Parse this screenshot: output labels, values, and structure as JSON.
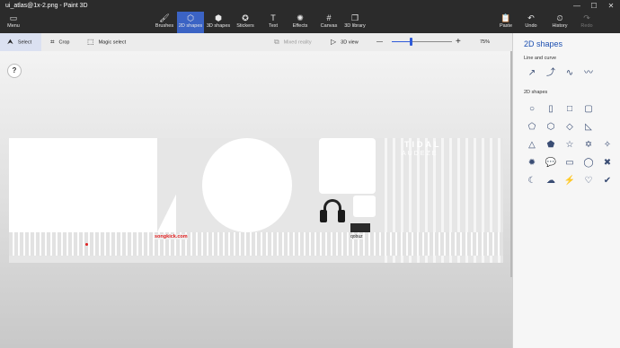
{
  "window": {
    "title": "ui_atlas@1x-2.png - Paint 3D",
    "minimize": "—",
    "maximize": "☐",
    "close": "✕"
  },
  "ribbon": {
    "menu": "Menu",
    "tabs": [
      {
        "label": "Brushes",
        "icon": "🖌"
      },
      {
        "label": "2D shapes",
        "icon": "⬡"
      },
      {
        "label": "3D shapes",
        "icon": "⬢"
      },
      {
        "label": "Stickers",
        "icon": "✪"
      },
      {
        "label": "Text",
        "icon": "T"
      },
      {
        "label": "Effects",
        "icon": "✺"
      },
      {
        "label": "Canvas",
        "icon": "#"
      },
      {
        "label": "3D library",
        "icon": "❒"
      }
    ],
    "actions": [
      {
        "label": "Paste",
        "icon": "📋"
      },
      {
        "label": "Undo",
        "icon": "↶"
      },
      {
        "label": "History",
        "icon": "⏲"
      },
      {
        "label": "Redo",
        "icon": "↷"
      }
    ]
  },
  "toolbar": {
    "select": "Select",
    "crop": "Crop",
    "magic_select": "Magic select",
    "mixed_reality": "Mixed reality",
    "view_3d": "3D view",
    "minus": "—",
    "plus": "+",
    "zoom": "75%"
  },
  "canvas": {
    "help": "?",
    "brand_tidal": "TIDAL",
    "brand_audeze": "AUDEZE",
    "brand_songkick": "songkick.com",
    "brand_qobuz": "qobuz"
  },
  "panel": {
    "title": "2D shapes",
    "line_section": "Line and curve",
    "shape_section": "2D shapes",
    "lines": [
      "↗",
      "⤴",
      "∿",
      "〰"
    ],
    "shapes": [
      "○",
      "▯",
      "□",
      "▢",
      "⬠",
      "⬡",
      "◇",
      "◺",
      "△",
      "⬟",
      "☆",
      "✡",
      "✧",
      "✹",
      "💬",
      "▭",
      "◯",
      "✖",
      "✔",
      "☾",
      "☁",
      "⚡",
      "♡"
    ]
  }
}
